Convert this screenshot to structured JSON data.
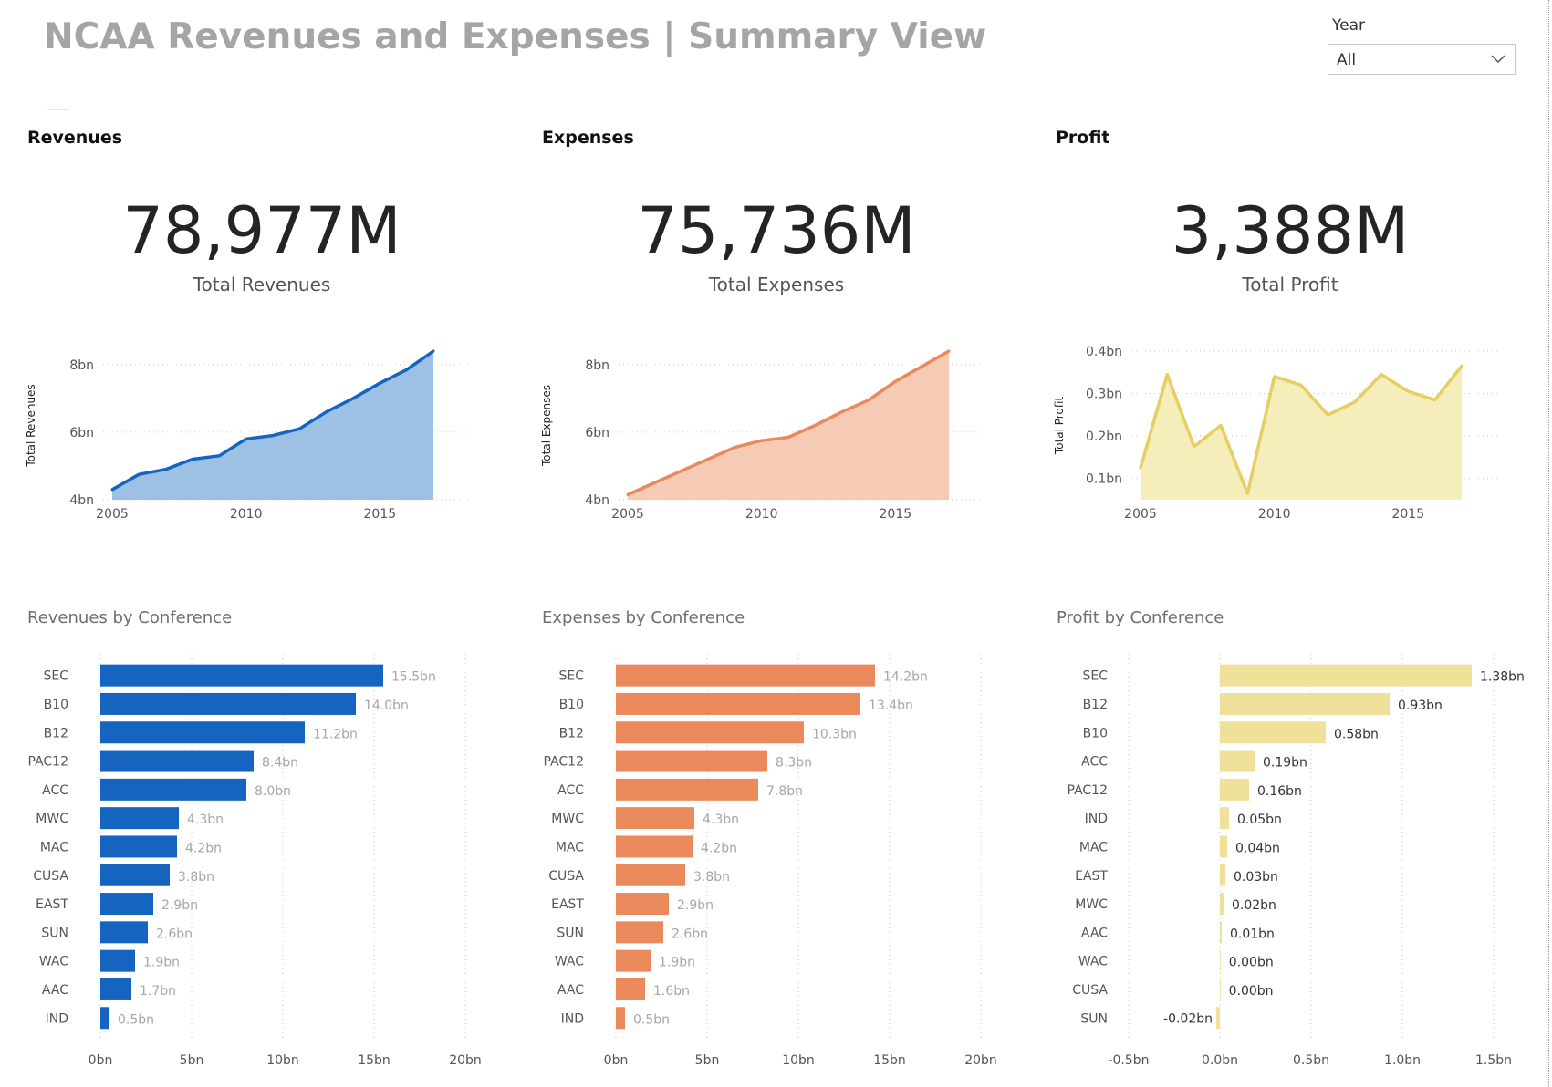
{
  "header": {
    "title": "NCAA Revenues and Expenses | Summary View",
    "filter_label": "Year",
    "filter_value": "All"
  },
  "colors": {
    "revenue_line": "#1565c0",
    "revenue_area": "#9dc1e5",
    "revenue_bar": "#1565c0",
    "expense_line": "#ea8a5c",
    "expense_area": "#f5cbb6",
    "expense_bar": "#ea8a5c",
    "profit_line": "#e5cf63",
    "profit_area": "#f5edba",
    "profit_bar": "#efe19a"
  },
  "panels": {
    "revenues": {
      "title": "Revenues",
      "kpi_value": "78,977M",
      "kpi_label": "Total Revenues",
      "bar_title": "Revenues by Conference"
    },
    "expenses": {
      "title": "Expenses",
      "kpi_value": "75,736M",
      "kpi_label": "Total Expenses",
      "bar_title": "Expenses by Conference"
    },
    "profit": {
      "title": "Profit",
      "kpi_value": "3,388M",
      "kpi_label": "Total Profit",
      "bar_title": "Profit by Conference"
    }
  },
  "chart_data": [
    {
      "id": "revenues_trend",
      "type": "area",
      "ylabel": "Total Revenues",
      "x": [
        2005,
        2006,
        2007,
        2008,
        2009,
        2010,
        2011,
        2012,
        2013,
        2014,
        2015,
        2016,
        2017
      ],
      "values": [
        4.3,
        4.75,
        4.9,
        5.2,
        5.3,
        5.8,
        5.9,
        6.1,
        6.6,
        7.0,
        7.45,
        7.85,
        8.4
      ],
      "ylim": [
        4,
        8.4
      ],
      "yticks": [
        4,
        6,
        8
      ],
      "ytick_labels": [
        "4bn",
        "6bn",
        "8bn"
      ],
      "xticks": [
        2005,
        2010,
        2015
      ],
      "grid": true
    },
    {
      "id": "expenses_trend",
      "type": "area",
      "ylabel": "Total Expenses",
      "x": [
        2005,
        2006,
        2007,
        2008,
        2009,
        2010,
        2011,
        2012,
        2013,
        2014,
        2015,
        2016,
        2017
      ],
      "values": [
        4.15,
        4.5,
        4.85,
        5.2,
        5.55,
        5.75,
        5.85,
        6.2,
        6.6,
        6.95,
        7.5,
        7.95,
        8.4
      ],
      "ylim": [
        4,
        8.4
      ],
      "yticks": [
        4,
        6,
        8
      ],
      "ytick_labels": [
        "4bn",
        "6bn",
        "8bn"
      ],
      "xticks": [
        2005,
        2010,
        2015
      ],
      "grid": true
    },
    {
      "id": "profit_trend",
      "type": "area",
      "ylabel": "Total Profit",
      "x": [
        2005,
        2006,
        2007,
        2008,
        2009,
        2010,
        2011,
        2012,
        2013,
        2014,
        2015,
        2016,
        2017
      ],
      "values": [
        0.125,
        0.345,
        0.175,
        0.225,
        0.065,
        0.34,
        0.32,
        0.25,
        0.28,
        0.345,
        0.305,
        0.285,
        0.365
      ],
      "ylim": [
        0.05,
        0.4
      ],
      "yticks": [
        0.1,
        0.2,
        0.3,
        0.4
      ],
      "ytick_labels": [
        "0.1bn",
        "0.2bn",
        "0.3bn",
        "0.4bn"
      ],
      "xticks": [
        2005,
        2010,
        2015
      ],
      "grid": true
    },
    {
      "id": "revenues_by_conference",
      "type": "bar",
      "orientation": "horizontal",
      "categories": [
        "SEC",
        "B10",
        "B12",
        "PAC12",
        "ACC",
        "MWC",
        "MAC",
        "CUSA",
        "EAST",
        "SUN",
        "WAC",
        "AAC",
        "IND"
      ],
      "values": [
        15.5,
        14.0,
        11.2,
        8.4,
        8.0,
        4.3,
        4.2,
        3.8,
        2.9,
        2.6,
        1.9,
        1.7,
        0.5
      ],
      "value_labels": [
        "15.5bn",
        "14.0bn",
        "11.2bn",
        "8.4bn",
        "8.0bn",
        "4.3bn",
        "4.2bn",
        "3.8bn",
        "2.9bn",
        "2.6bn",
        "1.9bn",
        "1.7bn",
        "0.5bn"
      ],
      "xlim": [
        0,
        20
      ],
      "xticks": [
        0,
        5,
        10,
        15,
        20
      ],
      "xtick_labels": [
        "0bn",
        "5bn",
        "10bn",
        "15bn",
        "20bn"
      ],
      "grid": true
    },
    {
      "id": "expenses_by_conference",
      "type": "bar",
      "orientation": "horizontal",
      "categories": [
        "SEC",
        "B10",
        "B12",
        "PAC12",
        "ACC",
        "MWC",
        "MAC",
        "CUSA",
        "EAST",
        "SUN",
        "WAC",
        "AAC",
        "IND"
      ],
      "values": [
        14.2,
        13.4,
        10.3,
        8.3,
        7.8,
        4.3,
        4.2,
        3.8,
        2.9,
        2.6,
        1.9,
        1.6,
        0.5
      ],
      "value_labels": [
        "14.2bn",
        "13.4bn",
        "10.3bn",
        "8.3bn",
        "7.8bn",
        "4.3bn",
        "4.2bn",
        "3.8bn",
        "2.9bn",
        "2.6bn",
        "1.9bn",
        "1.6bn",
        "0.5bn"
      ],
      "xlim": [
        0,
        20
      ],
      "xticks": [
        0,
        5,
        10,
        15,
        20
      ],
      "xtick_labels": [
        "0bn",
        "5bn",
        "10bn",
        "15bn",
        "20bn"
      ],
      "grid": true
    },
    {
      "id": "profit_by_conference",
      "type": "bar",
      "orientation": "horizontal",
      "categories": [
        "SEC",
        "B12",
        "B10",
        "ACC",
        "PAC12",
        "IND",
        "MAC",
        "EAST",
        "MWC",
        "AAC",
        "WAC",
        "CUSA",
        "SUN"
      ],
      "values": [
        1.38,
        0.93,
        0.58,
        0.19,
        0.16,
        0.05,
        0.04,
        0.03,
        0.02,
        0.01,
        0.004,
        0.003,
        -0.02
      ],
      "value_labels": [
        "1.38bn",
        "0.93bn",
        "0.58bn",
        "0.19bn",
        "0.16bn",
        "0.05bn",
        "0.04bn",
        "0.03bn",
        "0.02bn",
        "0.01bn",
        "0.00bn",
        "0.00bn",
        "-0.02bn"
      ],
      "xlim": [
        -0.5,
        1.5
      ],
      "xticks": [
        -0.5,
        0,
        0.5,
        1.0,
        1.5
      ],
      "xtick_labels": [
        "-0.5bn",
        "0.0bn",
        "0.5bn",
        "1.0bn",
        "1.5bn"
      ],
      "grid": true
    }
  ]
}
